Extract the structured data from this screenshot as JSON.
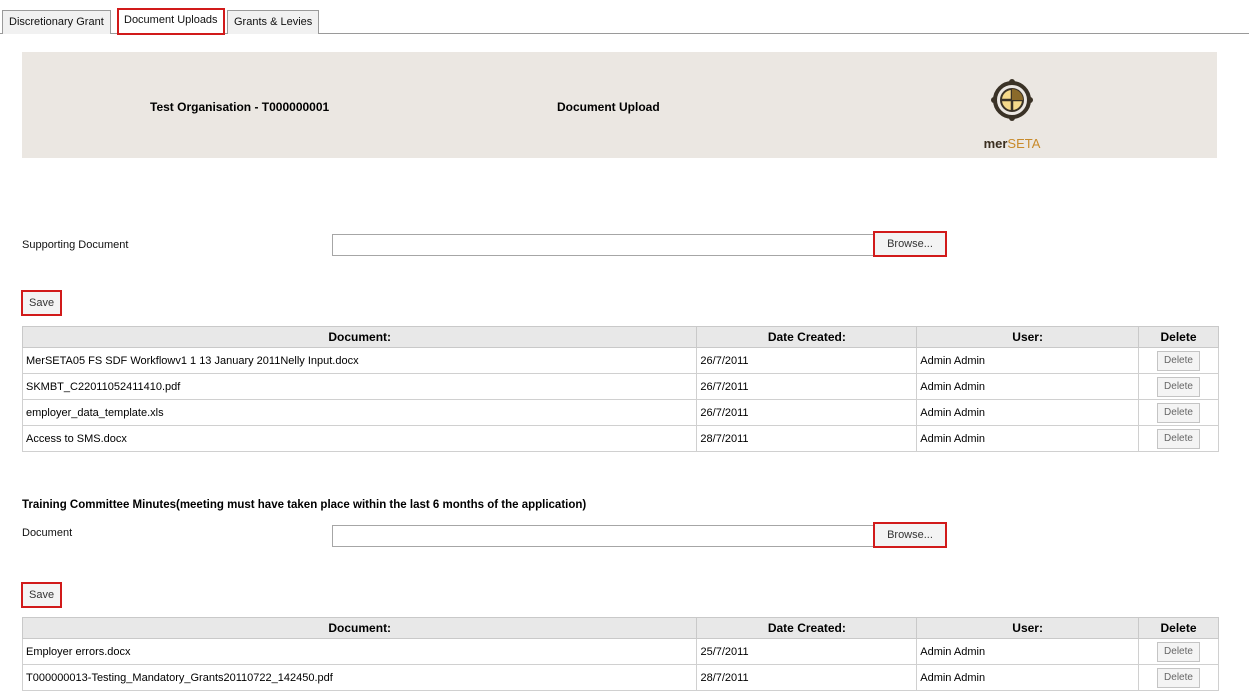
{
  "tabs": [
    {
      "label": "Discretionary Grant"
    },
    {
      "label": "Document Uploads"
    },
    {
      "label": "Grants & Levies"
    }
  ],
  "header": {
    "organisation": "Test Organisation - T000000001",
    "title": "Document Upload",
    "logo_text_a": "mer",
    "logo_text_b": "SETA"
  },
  "supporting": {
    "label": "Supporting Document",
    "browse_label": "Browse...",
    "save_label": "Save"
  },
  "table_headers": {
    "document": "Document:",
    "date": "Date Created:",
    "user": "User:",
    "delete": "Delete"
  },
  "supporting_docs": [
    {
      "document": "MerSETA05 FS SDF Workflowv1 1 13 January 2011Nelly Input.docx",
      "date": "26/7/2011",
      "user": "Admin Admin",
      "delete": "Delete"
    },
    {
      "document": "SKMBT_C22011052411410.pdf",
      "date": "26/7/2011",
      "user": "Admin Admin",
      "delete": "Delete"
    },
    {
      "document": "employer_data_template.xls",
      "date": "26/7/2011",
      "user": "Admin Admin",
      "delete": "Delete"
    },
    {
      "document": "Access to SMS.docx",
      "date": "28/7/2011",
      "user": "Admin Admin",
      "delete": "Delete"
    }
  ],
  "training": {
    "title": "Training Committee Minutes(meeting must have taken place within the last 6 months of the application)",
    "label": "Document",
    "browse_label": "Browse...",
    "save_label": "Save"
  },
  "training_docs": [
    {
      "document": "Employer errors.docx",
      "date": "25/7/2011",
      "user": "Admin Admin",
      "delete": "Delete"
    },
    {
      "document": "T000000013-Testing_Mandatory_Grants20110722_142450.pdf",
      "date": "28/7/2011",
      "user": "Admin Admin",
      "delete": "Delete"
    }
  ]
}
